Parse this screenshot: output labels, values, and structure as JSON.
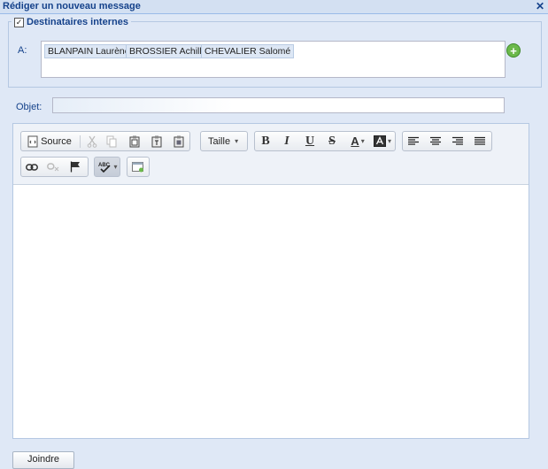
{
  "window": {
    "title": "Rédiger un nouveau message",
    "close_glyph": "✕"
  },
  "recipients": {
    "section_label": "Destinataires internes",
    "section_checked": true,
    "to_label": "A:",
    "chips": [
      "BLANPAIN Laurène",
      "BROSSIER Achille",
      "CHEVALIER Salomé"
    ],
    "add_glyph": "+"
  },
  "subject": {
    "label": "Objet:",
    "value": ""
  },
  "editor": {
    "source_label": "Source",
    "size_label": "Taille",
    "bold_label": "B",
    "italic_label": "I",
    "underline_label": "U",
    "strike_label": "S",
    "textcolor_label": "A",
    "caret_glyph": "▾",
    "content": ""
  },
  "footer": {
    "attach_label": "Joindre"
  },
  "colors": {
    "title": "#15428b",
    "panel_bg": "#dfe8f6",
    "add_green": "#6cb94b"
  }
}
